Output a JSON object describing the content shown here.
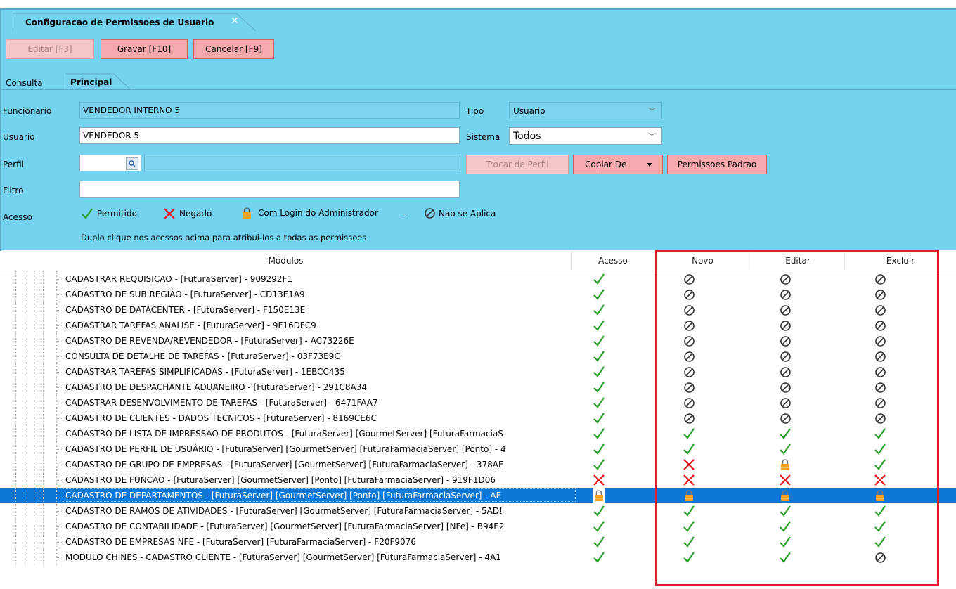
{
  "window": {
    "tab_title": "Configuracao de Permissoes de Usuario"
  },
  "toolbar": {
    "edit_label": "Editar [F3]",
    "save_label": "Gravar [F10]",
    "cancel_label": "Cancelar [F9]"
  },
  "tabs": {
    "consulta": "Consulta",
    "principal": "Principal"
  },
  "form": {
    "funcionario_label": "Funcionario",
    "funcionario_value": "VENDEDOR INTERNO 5",
    "usuario_label": "Usuario",
    "usuario_value": "VENDEDOR 5",
    "perfil_label": "Perfil",
    "filtro_label": "Filtro",
    "acesso_label": "Acesso",
    "tipo_label": "Tipo",
    "tipo_value": "Usuario",
    "sistema_label": "Sistema",
    "sistema_value": "Todos",
    "trocar_perfil": "Trocar de Perfil",
    "copiar_de": "Copiar De",
    "permissoes_padrao": "Permissoes Padrao"
  },
  "legend": {
    "permitido": "Permitido",
    "negado": "Negado",
    "admin": "Com Login do Administrador",
    "dash": "-",
    "nao_aplica": "Nao se Aplica",
    "hint": "Duplo clique nos acessos acima para atribui-los a todas as permissoes"
  },
  "grid": {
    "headers": {
      "modulos": "Módulos",
      "acesso": "Acesso",
      "novo": "Novo",
      "editar": "Editar",
      "excluir": "Excluir"
    },
    "rows": [
      {
        "m": "CADASTRAR REQUISICAO - [FuturaServer]  - 909292F1",
        "a": "check",
        "n": "na",
        "e": "na",
        "x": "na"
      },
      {
        "m": "CADASTRO DE SUB REGIÃO - [FuturaServer]  - CD13E1A9",
        "a": "check",
        "n": "na",
        "e": "na",
        "x": "na"
      },
      {
        "m": "CADASTRO DE DATACENTER - [FuturaServer]  - F150E13E",
        "a": "check",
        "n": "na",
        "e": "na",
        "x": "na"
      },
      {
        "m": "CADASTRAR TAREFAS ANALISE - [FuturaServer]  - 9F16DFC9",
        "a": "check",
        "n": "na",
        "e": "na",
        "x": "na"
      },
      {
        "m": "CADASTRO DE REVENDA/REVENDEDOR - [FuturaServer]  - AC73226E",
        "a": "check",
        "n": "na",
        "e": "na",
        "x": "na"
      },
      {
        "m": "CONSULTA DE DETALHE DE TAREFAS - [FuturaServer]  - 03F73E9C",
        "a": "check",
        "n": "na",
        "e": "na",
        "x": "na"
      },
      {
        "m": "CADASTRAR TAREFAS SIMPLIFICADAS - [FuturaServer]  - 1EBCC435",
        "a": "check",
        "n": "na",
        "e": "na",
        "x": "na"
      },
      {
        "m": "CADASTRO DE DESPACHANTE ADUANEIRO - [FuturaServer]  - 291C8A34",
        "a": "check",
        "n": "na",
        "e": "na",
        "x": "na"
      },
      {
        "m": "CADASTRAR DESENVOLVIMENTO DE TAREFAS - [FuturaServer]  - 6471FAA7",
        "a": "check",
        "n": "na",
        "e": "na",
        "x": "na"
      },
      {
        "m": "CADASTRO DE CLIENTES - DADOS TECNICOS - [FuturaServer]  - 8169CE6C",
        "a": "check",
        "n": "na",
        "e": "na",
        "x": "na"
      },
      {
        "m": "CADASTRO DE LISTA DE IMPRESSAO DE PRODUTOS - [FuturaServer] [GourmetServer] [FuturaFarmaciaS",
        "a": "check",
        "n": "check",
        "e": "check",
        "x": "check"
      },
      {
        "m": "CADASTRO DE PERFIL DE USUÁRIO - [FuturaServer] [GourmetServer] [FuturaFarmaciaServer] [Ponto]  - 4",
        "a": "check",
        "n": "check",
        "e": "check",
        "x": "check"
      },
      {
        "m": "CADASTRO DE GRUPO DE EMPRESAS - [FuturaServer] [GourmetServer] [FuturaFarmaciaServer]  - 378AE",
        "a": "check",
        "n": "cross",
        "e": "lock",
        "x": "check"
      },
      {
        "m": "CADASTRO DE FUNCAO - [FuturaServer] [GourmetServer] [Ponto] [FuturaFarmaciaServer]  - 919F1D06",
        "a": "cross",
        "n": "cross",
        "e": "cross",
        "x": "cross"
      },
      {
        "m": "CADASTRO DE DEPARTAMENTOS - [FuturaServer] [GourmetServer] [Ponto] [FuturaFarmaciaServer]  - AE",
        "a": "lock",
        "n": "lock",
        "e": "lock",
        "x": "lock",
        "selected": true
      },
      {
        "m": "CADASTRO DE RAMOS DE ATIVIDADES - [FuturaServer] [GourmetServer] [FuturaFarmaciaServer]  - 5AD!",
        "a": "check",
        "n": "check",
        "e": "check",
        "x": "check"
      },
      {
        "m": "CADASTRO DE CONTABILIDADE - [FuturaServer] [GourmetServer] [FuturaFarmaciaServer] [NFe]  - B94E2",
        "a": "check",
        "n": "check",
        "e": "check",
        "x": "check"
      },
      {
        "m": "CADASTRO DE EMPRESAS NFE - [FuturaServer] [FuturaFarmaciaServer]  - F20F9076",
        "a": "check",
        "n": "check",
        "e": "check",
        "x": "check"
      },
      {
        "m": "MODULO CHINES - CADASTRO CLIENTE - [FuturaServer] [GourmetServer] [FuturaFarmaciaServer]  - 4A1",
        "a": "check",
        "n": "check",
        "e": "check",
        "x": "na"
      }
    ]
  },
  "colors": {
    "panel": "#74d3ef",
    "button": "#f6a9ad",
    "highlight": "#e01e2b",
    "selection": "#0d78d8",
    "check": "#2aa02a",
    "cross": "#e8141e",
    "lock": "#f2a21c"
  }
}
